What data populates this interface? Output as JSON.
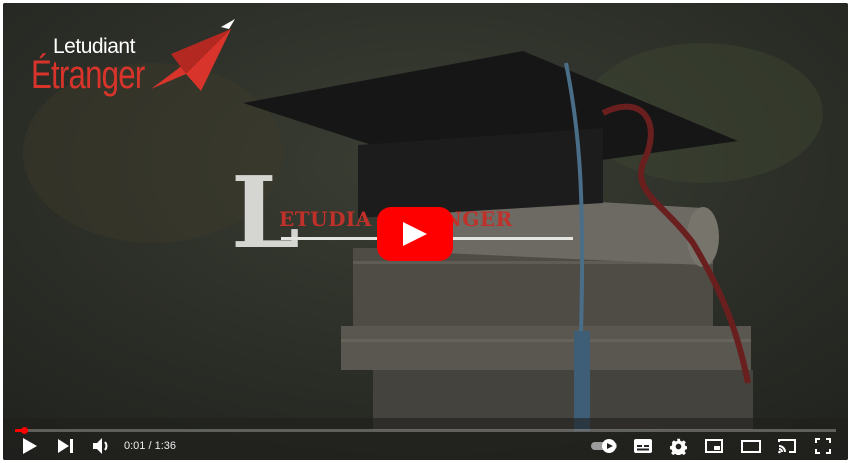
{
  "logo": {
    "line1": "Letudiant",
    "line2": "Étranger"
  },
  "title_overlay": {
    "initial": "L",
    "word": "ETUDIA          ÉTRANGER"
  },
  "player": {
    "time_current": "0:01",
    "time_separator": " / ",
    "time_total": "1:36",
    "progress": 0.0104,
    "accent_color": "#ff0000"
  },
  "icons": {
    "play": "play-icon",
    "next": "next-icon",
    "volume": "volume-icon",
    "autoplay": "autoplay-toggle-icon",
    "subtitles": "subtitles-icon",
    "settings": "gear-icon",
    "miniplayer": "miniplayer-icon",
    "theater": "theater-icon",
    "cast": "cast-icon",
    "fullscreen": "fullscreen-icon"
  }
}
